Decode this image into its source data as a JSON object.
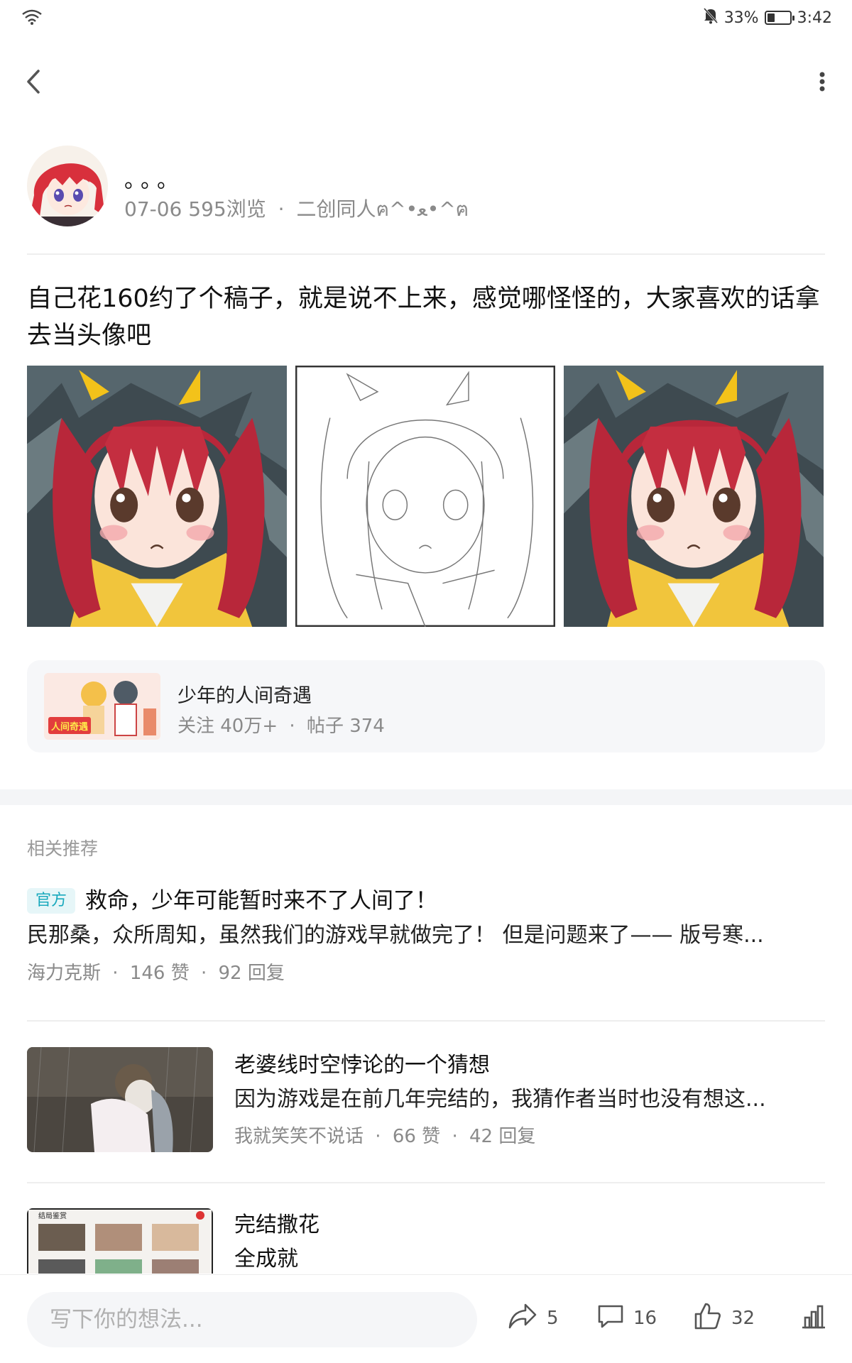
{
  "status_bar": {
    "battery_text": "33%",
    "battery_level": 0.33,
    "time": "3:42",
    "icons": [
      "wifi-icon",
      "mute-icon",
      "battery-icon"
    ]
  },
  "nav": {
    "back_icon": "back-arrow-icon",
    "more_icon": "more-vertical-icon"
  },
  "author": {
    "name": "。。。",
    "date": "07-06",
    "views": "595浏览",
    "category": "二创同人ฅ^•ﻌ•^ฅ"
  },
  "post": {
    "text": "自己花160约了个稿子，就是说不上来，感觉哪怪怪的，大家喜欢的话拿去当头像吧",
    "images": [
      "colored-portrait",
      "sketch-portrait",
      "colored-portrait"
    ]
  },
  "topic": {
    "title": "少年的人间奇遇",
    "followers": "关注 40万+",
    "posts": "帖子 374",
    "thumb_text": "人间奇遇"
  },
  "related": {
    "section_title": "相关推荐",
    "items": [
      {
        "tag": "官方",
        "title": "救命，少年可能暂时来不了人间了！",
        "excerpt": "民那桑，众所周知，虽然我们的游戏早就做完了！ 但是问题来了—— 版号寒...",
        "author": "海力克斯",
        "likes": "146 赞",
        "replies": "92 回复"
      },
      {
        "title": "老婆线时空悖论的一个猜想",
        "excerpt": "因为游戏是在前几年完结的，我猜作者当时也没有想这...",
        "author": "我就笑笑不说话",
        "likes": "66 赞",
        "replies": "42 回复"
      },
      {
        "title": "完结撒花",
        "excerpt": "全成就",
        "thumb_label": "结局鉴赏"
      }
    ]
  },
  "bottom_bar": {
    "placeholder": "写下你的想法...",
    "share_count": "5",
    "comment_count": "16",
    "like_count": "32"
  },
  "colors": {
    "official_tag_bg": "#e6f6f8",
    "official_tag_text": "#19a9bd",
    "hair_red": "#b8273a",
    "jacket_yellow": "#f1c53c"
  }
}
